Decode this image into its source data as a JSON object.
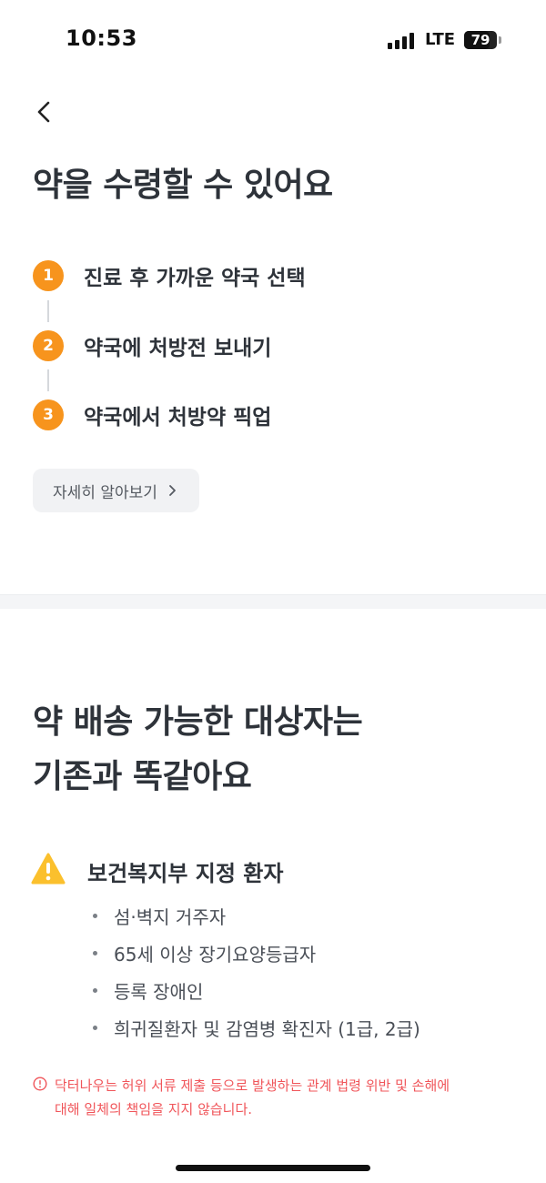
{
  "status_bar": {
    "time": "10:53",
    "network": "LTE",
    "battery": "79",
    "battery_level": 0.79
  },
  "header": {
    "back_icon": "chevron-left-icon"
  },
  "section1": {
    "title": "약을 수령할 수 있어요",
    "steps": [
      {
        "number": "1",
        "label": "진료 후 가까운 약국 선택"
      },
      {
        "number": "2",
        "label": "약국에 처방전 보내기"
      },
      {
        "number": "3",
        "label": "약국에서 처방약 픽업"
      }
    ],
    "step_color": "#f7941d",
    "more_button": "자세히 알아보기",
    "more_icon": "chevron-right-icon"
  },
  "section2": {
    "title_line1": "약 배송 가능한 대상자는",
    "title_line2": "기존과 똑같아요",
    "warning_icon": "warning-triangle-icon",
    "warning_color": "#fbc02d",
    "target_title": "보건복지부 지정 환자",
    "targets": [
      "섬·벽지 거주자",
      "65세 이상 장기요양등급자",
      "등록 장애인",
      "희귀질환자 및 감염병 확진자 (1급, 2급)"
    ],
    "disclaimer_icon": "alert-circle-icon",
    "disclaimer_line1": "닥터나우는 허위 서류 제출 등으로 발생하는 관계 법령 위반 및 손해에",
    "disclaimer_line2": "대해 일체의 책임을 지지 않습니다.",
    "disclaimer_color": "#f0555a"
  }
}
